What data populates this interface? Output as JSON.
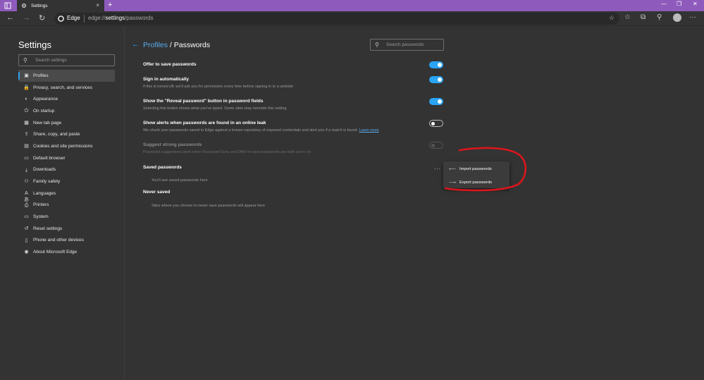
{
  "browser": {
    "tab_title": "Settings",
    "tab_close": "×",
    "new_tab": "+",
    "win_min": "—",
    "win_max": "❐",
    "win_close": "✕",
    "back": "←",
    "forward": "→",
    "refresh": "↻",
    "address_brand": "Edge",
    "url_prefix": "edge://",
    "url_host": "settings",
    "url_path": "/passwords",
    "more": "···"
  },
  "sidebar": {
    "title": "Settings",
    "search_placeholder": "Search settings",
    "items": [
      {
        "label": "Profiles",
        "icon": "person-icon",
        "glyph": "▣",
        "active": true
      },
      {
        "label": "Privacy, search, and services",
        "icon": "lock-icon",
        "glyph": "🔒"
      },
      {
        "label": "Appearance",
        "icon": "palette-icon",
        "glyph": "◐"
      },
      {
        "label": "On startup",
        "icon": "power-icon",
        "glyph": "⏻"
      },
      {
        "label": "New tab page",
        "icon": "newtab-icon",
        "glyph": "▦"
      },
      {
        "label": "Share, copy, and paste",
        "icon": "share-icon",
        "glyph": "⇪"
      },
      {
        "label": "Cookies and site permissions",
        "icon": "permissions-icon",
        "glyph": "▤"
      },
      {
        "label": "Default browser",
        "icon": "browser-icon",
        "glyph": "▭"
      },
      {
        "label": "Downloads",
        "icon": "download-icon",
        "glyph": "⤓"
      },
      {
        "label": "Family safety",
        "icon": "family-icon",
        "glyph": "⚇"
      },
      {
        "label": "Languages",
        "icon": "language-icon",
        "glyph": "Aあ"
      },
      {
        "label": "Printers",
        "icon": "printer-icon",
        "glyph": "⎙"
      },
      {
        "label": "System",
        "icon": "system-icon",
        "glyph": "▭"
      },
      {
        "label": "Reset settings",
        "icon": "reset-icon",
        "glyph": "↺"
      },
      {
        "label": "Phone and other devices",
        "icon": "phone-icon",
        "glyph": "▯"
      },
      {
        "label": "About Microsoft Edge",
        "icon": "edge-icon",
        "glyph": "◉"
      }
    ]
  },
  "main": {
    "breadcrumb_parent": "Profiles",
    "breadcrumb_current": " / Passwords",
    "search_placeholder": "Search passwords",
    "settings": [
      {
        "label": "Offer to save passwords",
        "desc": "",
        "state": "on"
      },
      {
        "label": "Sign in automatically",
        "desc": "If this is turned off, we'll ask you for permission every time before signing in to a website",
        "state": "on"
      },
      {
        "label": "Show the \"Reveal password\" button in password fields",
        "desc": "Selecting this button shows what you've typed. Some sites may override this setting",
        "state": "on"
      },
      {
        "label": "Show alerts when passwords are found in an online leak",
        "desc": "We check your passwords saved in Edge against a known repository of exposed credentials and alert you if a match is found.",
        "link": "Learn more",
        "state": "off"
      },
      {
        "label": "Suggest strong passwords",
        "desc": "Password suggestions work when Password Sync and Offer to save passwords are both set to on",
        "state": "disabled"
      }
    ],
    "saved_title": "Saved passwords",
    "saved_empty": "You'll see saved passwords here",
    "saved_more": "···",
    "never_title": "Never saved",
    "never_empty": "Sites where you choose to never save passwords will appear here",
    "menu": [
      {
        "label": "Import passwords",
        "icon": "import-icon",
        "glyph": "⟵"
      },
      {
        "label": "Export passwords",
        "icon": "export-icon",
        "glyph": "⟶"
      }
    ]
  },
  "colors": {
    "titlebar": "#8e5bbd",
    "accent": "#2aa4f4",
    "background": "#333333",
    "annotation": "#e0141c"
  }
}
